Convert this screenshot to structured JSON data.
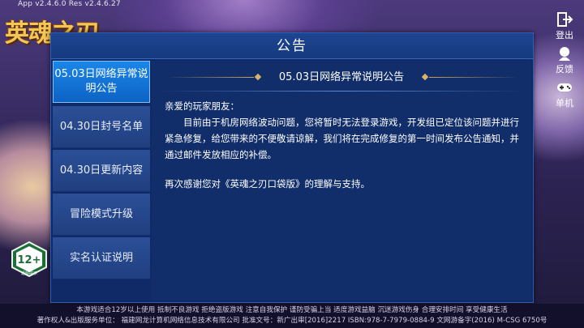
{
  "app": {
    "version_text": "App v2.4.6.0   Res v2.4.6.27",
    "logo_text": "英魂之刃",
    "age_rating": "12+",
    "age_rating_caption": "适龄提示"
  },
  "side_menu": [
    {
      "label": "登出",
      "icon": "logout-icon"
    },
    {
      "label": "反馈",
      "icon": "feedback-icon"
    },
    {
      "label": "单机",
      "icon": "gamepad-icon"
    }
  ],
  "dialog": {
    "title": "公告",
    "tabs": [
      {
        "label": "05.03日网络异常说明公告",
        "active": true
      },
      {
        "label": "04.30日封号名单",
        "active": false
      },
      {
        "label": "04.30日更新内容",
        "active": false
      },
      {
        "label": "冒险模式升级",
        "active": false
      },
      {
        "label": "实名认证说明",
        "active": false
      }
    ],
    "content": {
      "title": "05.03日网络异常说明公告",
      "greeting": "亲爱的玩家朋友：",
      "paragraph": "目前由于机房网络波动问题，您将暂时无法登录游戏，开发组已定位该问题并进行紧急修复，给您带来的不便敬请谅解，我们将在完成修复的第一时间发布公告通知，并通过邮件发放相应的补偿。",
      "closing": "再次感谢您对《英魂之刃口袋版》的理解与支持。"
    }
  },
  "footer": {
    "line1": "本游戏适合12岁以上使用 抵制不良游戏 拒绝盗版游戏 注意自我保护 谨防受骗上当 适度游戏益脑 沉迷游戏伤身 合理安排时间 享受健康生活",
    "line2": "著作权人&出版服务单位：  福建网龙计算机网络信息技术有限公司 批准文号：新广出审[2016]2217 ISBN:978-7-7979-0884-9 文网游备字(2016) M-CSG 6750号"
  },
  "colors": {
    "dialog_bg": "#0f2a66",
    "tab_active": "#0d63c4",
    "tab_inactive": "#203f80",
    "accent_gold": "#c9a35a"
  }
}
